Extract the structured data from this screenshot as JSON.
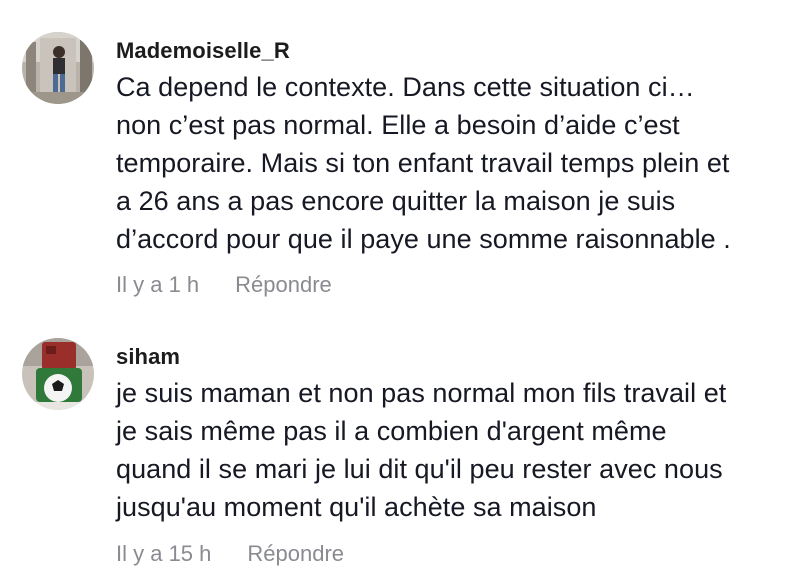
{
  "comments": [
    {
      "username": "Mademoiselle_R",
      "avatar_icon": "user-photo-avatar",
      "text": "Ca depend le contexte. Dans cette situation ci…\nnon c’est pas normal. Elle a besoin d’aide c’est\ntemporaire. Mais si ton enfant travail temps plein et\na 26 ans a pas encore quitter la maison je suis\nd’accord pour que il paye une somme raisonnable .",
      "time": "Il y a 1 h",
      "reply_label": "Répondre"
    },
    {
      "username": "siham",
      "avatar_icon": "cake-photo-avatar",
      "text": "je suis maman et non pas normal mon fils travail et\nje sais même pas il a combien d'argent même\nquand il se mari je lui dit qu'il peu rester avec nous\njusqu'au moment qu'il achète sa maison",
      "time": "Il y a 15 h",
      "reply_label": "Répondre"
    }
  ],
  "colors": {
    "text": "#161823",
    "meta": "#8a8b91"
  }
}
